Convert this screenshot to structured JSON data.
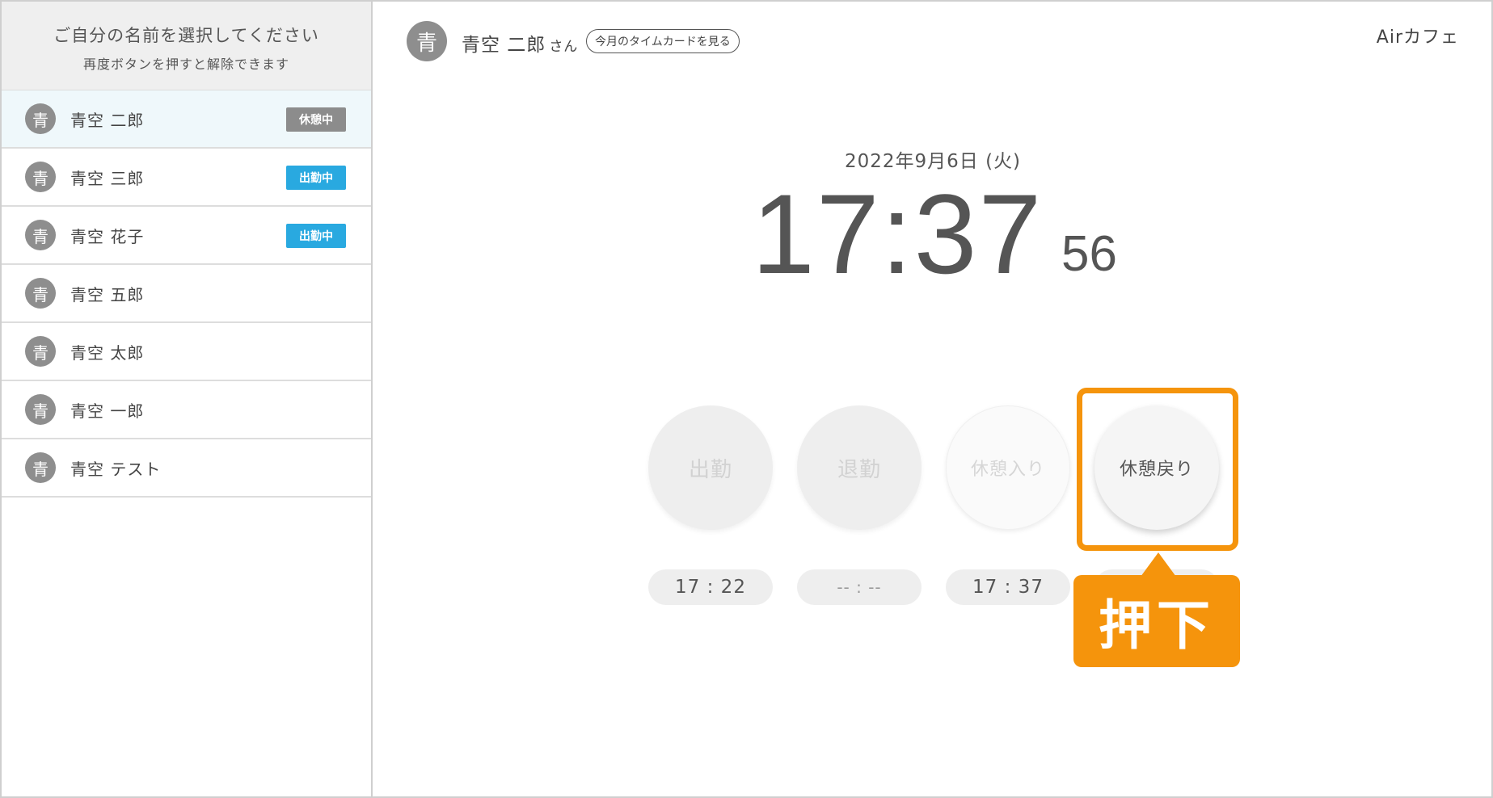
{
  "sidebar": {
    "heading": "ご自分の名前を選択してください",
    "subheading": "再度ボタンを押すと解除できます",
    "staff": [
      {
        "avatar": "青",
        "name": "青空 二郎",
        "status": "休憩中",
        "status_color": "#8c8c8c",
        "selected": true
      },
      {
        "avatar": "青",
        "name": "青空 三郎",
        "status": "出勤中",
        "status_color": "#29a9e0",
        "selected": false
      },
      {
        "avatar": "青",
        "name": "青空 花子",
        "status": "出勤中",
        "status_color": "#29a9e0",
        "selected": false
      },
      {
        "avatar": "青",
        "name": "青空 五郎",
        "status": "",
        "selected": false
      },
      {
        "avatar": "青",
        "name": "青空 太郎",
        "status": "",
        "selected": false
      },
      {
        "avatar": "青",
        "name": "青空 一郎",
        "status": "",
        "selected": false
      },
      {
        "avatar": "青",
        "name": "青空 テスト",
        "status": "",
        "selected": false
      }
    ]
  },
  "header": {
    "avatar": "青",
    "user_name": "青空 二郎",
    "honorific": "さん",
    "timecard_button": "今月のタイムカードを見る",
    "store_name": "Airカフェ"
  },
  "clock": {
    "date": "2022年9月6日 (火)",
    "time": "17:37",
    "seconds": "56"
  },
  "actions": {
    "clock_in": {
      "label": "出勤",
      "time": "17 : 22"
    },
    "clock_out": {
      "label": "退勤",
      "time": "-- : --"
    },
    "break_start": {
      "label": "休憩入り",
      "time": "17 : 37"
    },
    "break_end": {
      "label": "休憩戻り",
      "time": ""
    }
  },
  "annotation": {
    "label": "押下",
    "color": "#f5940c"
  }
}
